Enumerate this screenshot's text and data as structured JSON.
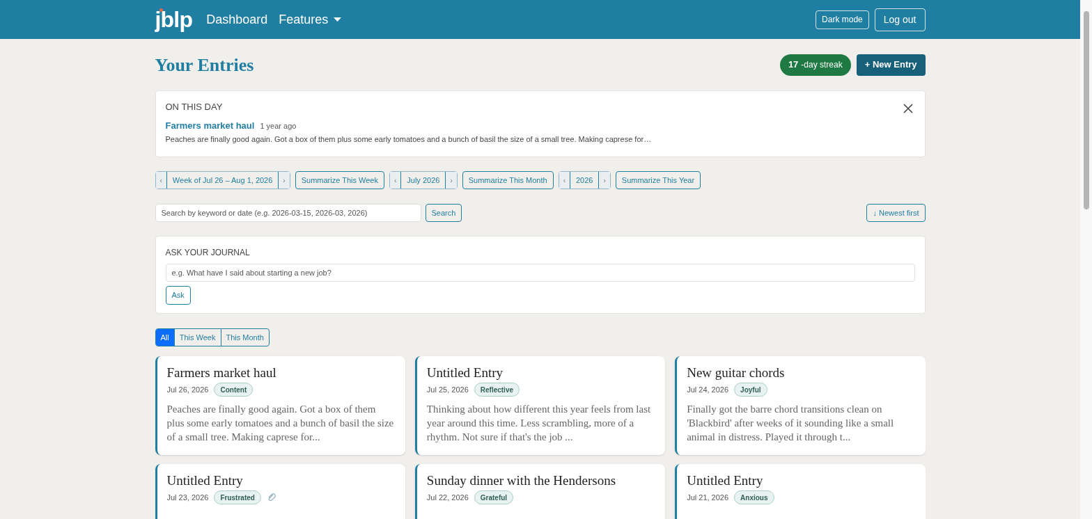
{
  "navbar": {
    "logo": "jblp",
    "links": [
      {
        "label": "Dashboard",
        "kind": "link"
      },
      {
        "label": "Features",
        "kind": "dropdown"
      }
    ],
    "buttons": [
      {
        "label": "Dark mode"
      },
      {
        "label": "Log out"
      }
    ]
  },
  "header": {
    "title": "Your Entries",
    "streak": {
      "count": "17",
      "label": "-day streak"
    },
    "new_entry": "+ New Entry"
  },
  "on_this_day": {
    "heading": "ON THIS DAY",
    "entry_title": "Farmers market haul",
    "age": "1 year ago",
    "excerpt": "Peaches are finally good again. Got a box of them plus some early tomatoes and a bunch of basil the size of a small tree. Making caprese for…"
  },
  "period_nav": [
    {
      "prev": "‹",
      "label": "Week of Jul 26 – Aug 1, 2026",
      "next": "›",
      "summarize": "Summarize This Week"
    },
    {
      "prev": "‹",
      "label": "July 2026",
      "next": "›",
      "summarize": "Summarize This Month"
    },
    {
      "prev": "‹",
      "label": "2026",
      "next": "›",
      "summarize": "Summarize This Year"
    }
  ],
  "search": {
    "placeholder": "Search by keyword or date (e.g. 2026-03-15, 2026-03, 2026)",
    "button": "Search",
    "sort": "↓ Newest first"
  },
  "ask": {
    "heading": "ASK YOUR JOURNAL",
    "placeholder": "e.g. What have I said about starting a new job?",
    "button": "Ask"
  },
  "filters": [
    {
      "label": "All",
      "selected": true
    },
    {
      "label": "This Week",
      "selected": false
    },
    {
      "label": "This Month",
      "selected": false
    }
  ],
  "entries": [
    {
      "title": "Farmers market haul",
      "date": "Jul 26, 2026",
      "mood": "Content",
      "attachment": false,
      "excerpt": "Peaches are finally good again. Got a box of them plus some early tomatoes and a bunch of basil the size of a small tree. Making caprese for..."
    },
    {
      "title": "Untitled Entry",
      "date": "Jul 25, 2026",
      "mood": "Reflective",
      "attachment": false,
      "excerpt": "Thinking about how different this year feels from last year around this time. Less scrambling, more of a rhythm. Not sure if that's the job ..."
    },
    {
      "title": "New guitar chords",
      "date": "Jul 24, 2026",
      "mood": "Joyful",
      "attachment": false,
      "excerpt": "Finally got the barre chord transitions clean on 'Blackbird' after weeks of it sounding like a small animal in distress. Played it through t..."
    },
    {
      "title": "Untitled Entry",
      "date": "Jul 23, 2026",
      "mood": "Frustrated",
      "attachment": true
    },
    {
      "title": "Sunday dinner with the Hendersons",
      "date": "Jul 22, 2026",
      "mood": "Grateful",
      "attachment": false
    },
    {
      "title": "Untitled Entry",
      "date": "Jul 21, 2026",
      "mood": "Anxious",
      "attachment": false
    }
  ]
}
